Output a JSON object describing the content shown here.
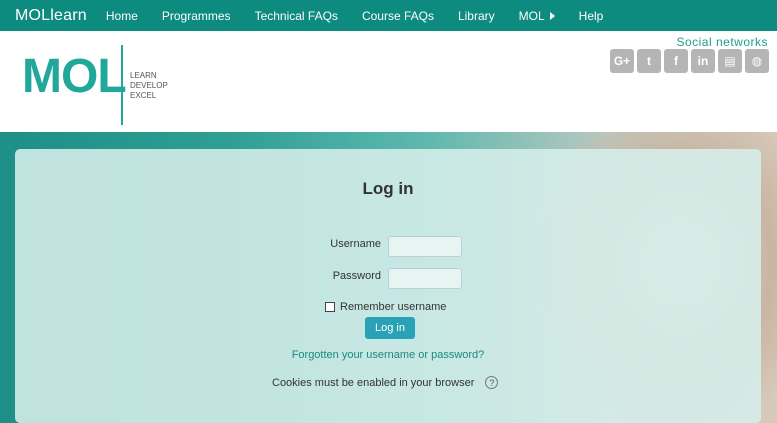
{
  "nav": {
    "brand": "MOLlearn",
    "items": [
      {
        "label": "Home"
      },
      {
        "label": "Programmes"
      },
      {
        "label": "Technical FAQs"
      },
      {
        "label": "Course FAQs"
      },
      {
        "label": "Library"
      },
      {
        "label": "MOL"
      },
      {
        "label": "Help"
      }
    ]
  },
  "header": {
    "logo_text": "MOL",
    "logo_tagline": [
      "LEARN",
      "DEVELOP",
      "EXCEL"
    ],
    "social_title": "Social networks",
    "social_icons": [
      {
        "name": "google-plus-icon",
        "glyph": "G+"
      },
      {
        "name": "twitter-icon",
        "glyph": "t"
      },
      {
        "name": "facebook-icon",
        "glyph": "f"
      },
      {
        "name": "linkedin-icon",
        "glyph": "in"
      },
      {
        "name": "book-icon",
        "glyph": "▤"
      },
      {
        "name": "globe-icon",
        "glyph": "◍"
      }
    ]
  },
  "login": {
    "title": "Log in",
    "username_label": "Username",
    "username_value": "",
    "password_label": "Password",
    "password_value": "",
    "remember_label": "Remember username",
    "remember_checked": false,
    "button_label": "Log in",
    "forgot_link": "Forgotten your username or password?",
    "cookies_text": "Cookies must be enabled in your browser",
    "help_glyph": "?"
  },
  "colors": {
    "nav_bg": "#0d8b7e",
    "brand_teal": "#22a79b",
    "button": "#29a1b6",
    "link": "#1a8a7c"
  }
}
